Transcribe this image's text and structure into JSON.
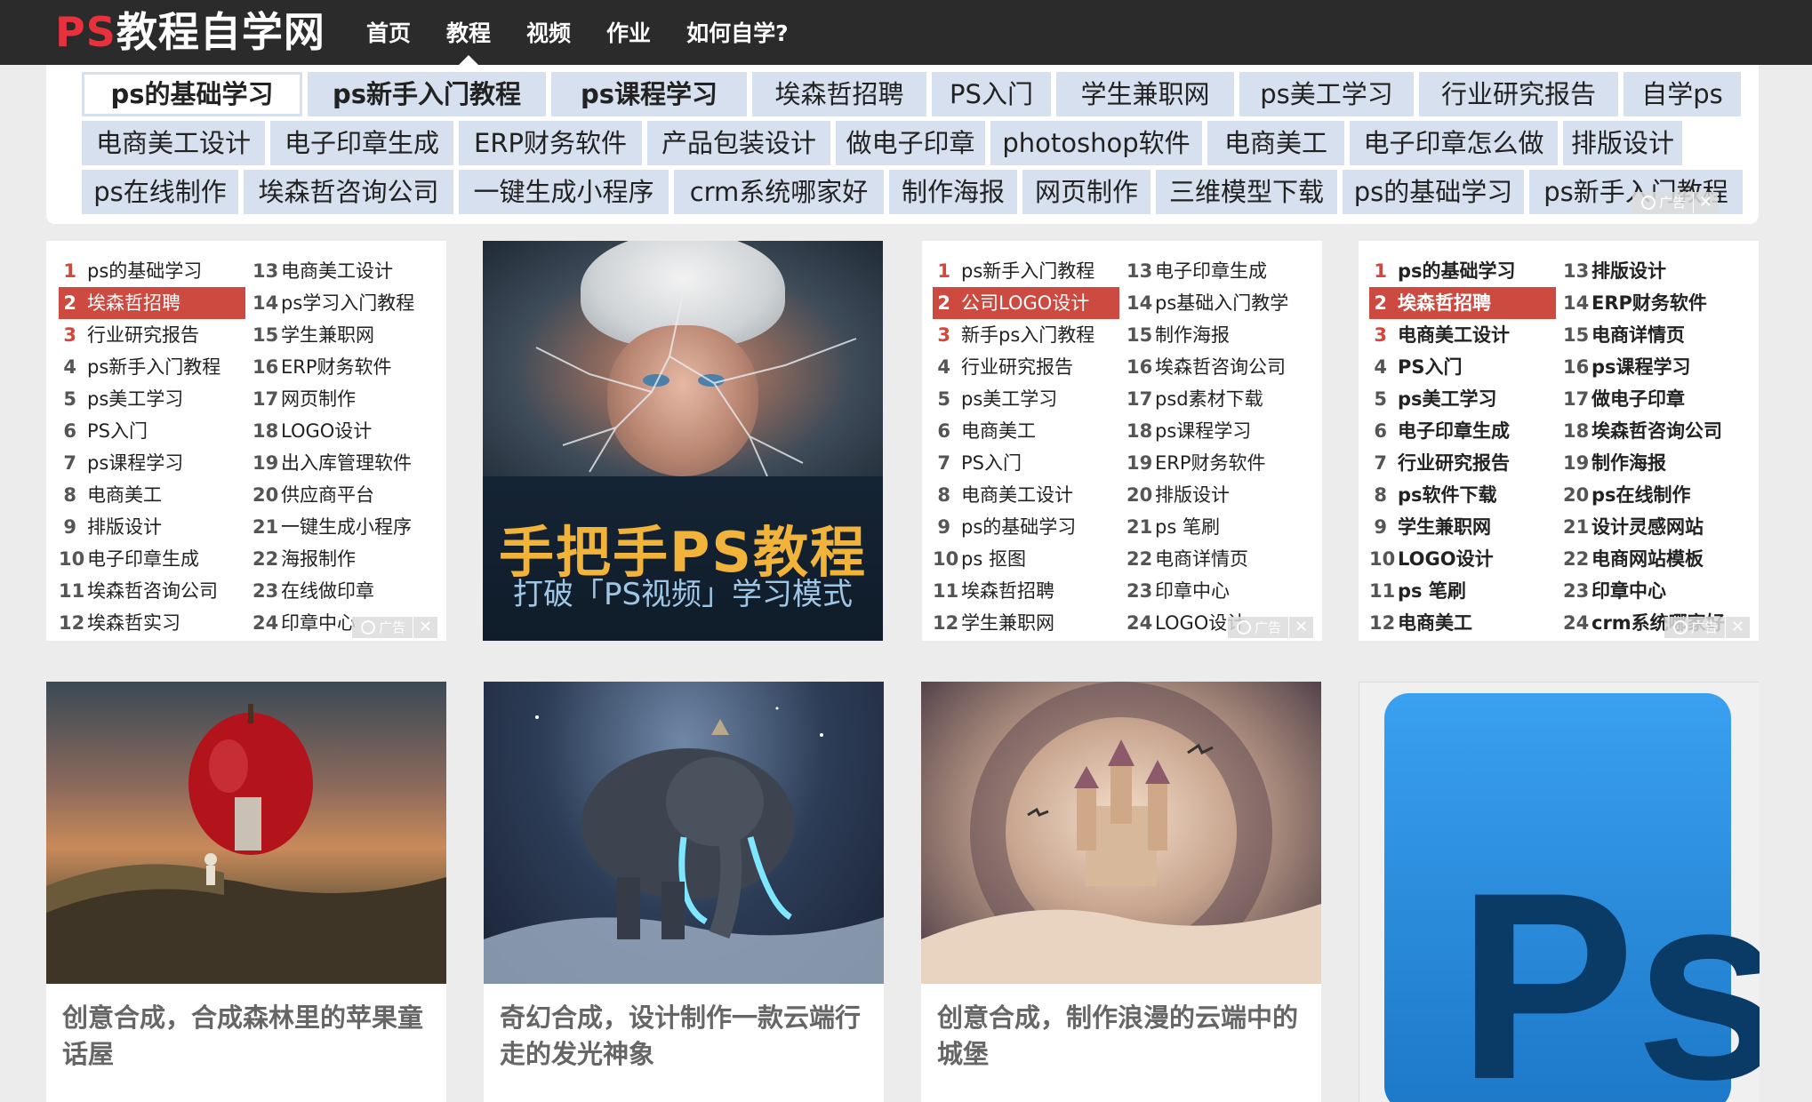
{
  "header": {
    "logo_ps": "PS",
    "logo_rest": "教程自学网",
    "nav": [
      {
        "label": "首页"
      },
      {
        "label": "教程"
      },
      {
        "label": "视频"
      },
      {
        "label": "作业"
      },
      {
        "label": "如何自学?"
      }
    ],
    "active_nav": "教程"
  },
  "keywords": {
    "rows": [
      [
        "ps的基础学习",
        "ps新手入门教程",
        "ps课程学习",
        "埃森哲招聘",
        "PS入门",
        "学生兼职网",
        "ps美工学习",
        "行业研究报告",
        "自学ps"
      ],
      [
        "电商美工设计",
        "电子印章生成",
        "ERP财务软件",
        "产品包装设计",
        "做电子印章",
        "photoshop软件",
        "电商美工",
        "电子印章怎么做",
        "排版设计"
      ],
      [
        "ps在线制作",
        "埃森哲咨询公司",
        "一键生成小程序",
        "crm系统哪家好",
        "制作海报",
        "网页制作",
        "三维模型下载",
        "ps的基础学习",
        "ps新手入门教程"
      ]
    ],
    "ad_label": "广告",
    "ad_close": "✕"
  },
  "rank_lists": [
    {
      "left": [
        "ps的基础学习",
        "埃森哲招聘",
        "行业研究报告",
        "ps新手入门教程",
        "ps美工学习",
        "PS入门",
        "ps课程学习",
        "电商美工",
        "排版设计",
        "电子印章生成",
        "埃森哲咨询公司",
        "埃森哲实习"
      ],
      "right": [
        "电商美工设计",
        "ps学习入门教程",
        "学生兼职网",
        "ERP财务软件",
        "网页制作",
        "LOGO设计",
        "出入库管理软件",
        "供应商平台",
        "一键生成小程序",
        "海报制作",
        "在线做印章",
        "印章中心"
      ]
    },
    {
      "left": [
        "ps新手入门教程",
        "公司LOGO设计",
        "新手ps入门教程",
        "行业研究报告",
        "ps美工学习",
        "电商美工",
        "PS入门",
        "电商美工设计",
        "ps的基础学习",
        "ps 抠图",
        "埃森哲招聘",
        "学生兼职网"
      ],
      "right": [
        "电子印章生成",
        "ps基础入门教学",
        "制作海报",
        "埃森哲咨询公司",
        "psd素材下载",
        "ps课程学习",
        "ERP财务软件",
        "排版设计",
        "ps 笔刷",
        "电商详情页",
        "印章中心",
        "LOGO设计"
      ]
    },
    {
      "left": [
        "ps的基础学习",
        "埃森哲招聘",
        "电商美工设计",
        "PS入门",
        "ps美工学习",
        "电子印章生成",
        "行业研究报告",
        "ps软件下载",
        "学生兼职网",
        "LOGO设计",
        "ps 笔刷",
        "电商美工"
      ],
      "right": [
        "排版设计",
        "ERP财务软件",
        "电商详情页",
        "ps课程学习",
        "做电子印章",
        "埃森哲咨询公司",
        "制作海报",
        "ps在线制作",
        "设计灵感网站",
        "电商网站模板",
        "印章中心",
        "crm系统哪家好"
      ]
    }
  ],
  "banner": {
    "title": "手把手PS教程",
    "subtitle": "打破「PS视频」学习模式"
  },
  "cards": [
    {
      "title": "创意合成，合成森林里的苹果童话屋"
    },
    {
      "title": "奇幻合成，设计制作一款云端行走的发光神象"
    },
    {
      "title": "创意合成，制作浪漫的云端中的城堡"
    },
    {
      "title": ""
    }
  ],
  "card_ps_text": "Ps",
  "colors": {
    "topbar": "#2b2b2b",
    "logo_red": "#e8313d",
    "keyword_bg": "#d6e0ee",
    "rank_highlight": "#cc4a3f",
    "rank_number_red": "#d2463c",
    "banner_title": "#f2b33a",
    "ps_blue": "#2a8ee0"
  }
}
